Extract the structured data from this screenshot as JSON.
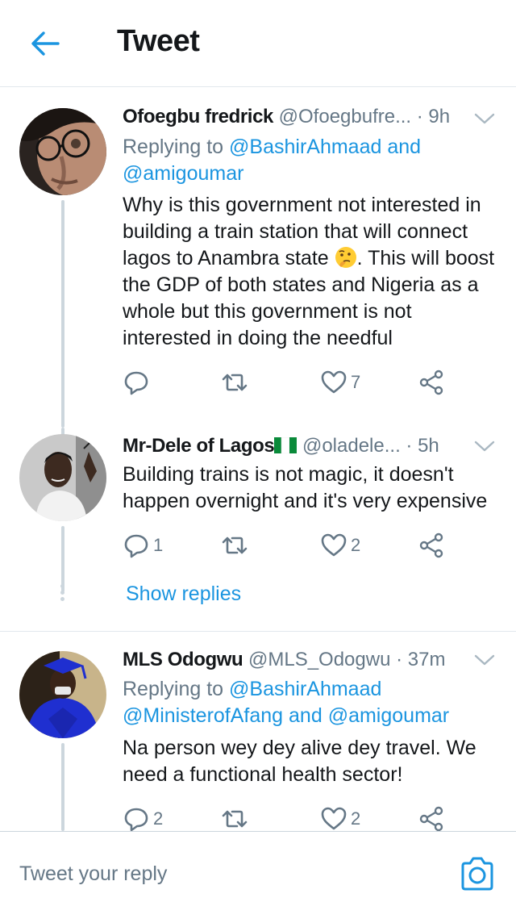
{
  "header": {
    "title": "Tweet",
    "back_icon": "arrow-left-icon",
    "accent": "#1b95e0"
  },
  "tweets": [
    {
      "name": "Ofoegbu fredrick",
      "handle": "@Ofoegbufre...",
      "time": "· 9h",
      "reply_prefix": "Replying to",
      "mentions": [
        "@BashirAhmaad",
        "and",
        "@amigoumar"
      ],
      "text_a": "Why is this government not interested in building a train station that will connect lagos to Anambra state",
      "emoji": "thinking-face-emoji",
      "text_b": ". This will boost the GDP of both states and Nigeria as a whole but this government is not interested in doing the needful",
      "reply_count": "",
      "retweet_count": "",
      "like_count": "7"
    },
    {
      "name": "Mr-Dele of Lagos",
      "flag": "nigeria-flag-emoji",
      "handle": "@oladele...",
      "time": "· 5h",
      "text": "Building trains is not magic, it doesn't happen overnight and it's very expensive",
      "reply_count": "1",
      "retweet_count": "",
      "like_count": "2"
    },
    {
      "name": "MLS Odogwu",
      "handle": "@MLS_Odogwu",
      "time": "· 37m",
      "reply_prefix": "Replying to",
      "mentions": [
        "@BashirAhmaad",
        "@MinisterofAfang",
        "and",
        "@amigoumar"
      ],
      "text": "Na person wey dey alive dey travel. We need a functional health sector!",
      "reply_count": "2",
      "retweet_count": "",
      "like_count": "2"
    }
  ],
  "show_replies": "Show replies",
  "composer": {
    "placeholder": "Tweet your reply",
    "camera_icon": "camera-icon"
  }
}
